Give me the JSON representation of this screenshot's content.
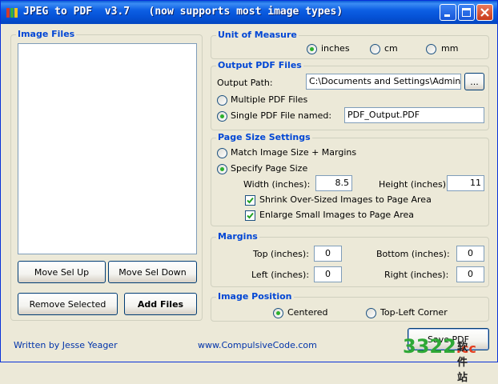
{
  "window": {
    "title": "JPEG to PDF  v3.7   (now supports most image types)"
  },
  "image_files": {
    "title": "Image Files",
    "items": [],
    "move_up_label": "Move Sel Up",
    "move_down_label": "Move Sel Down",
    "remove_label": "Remove Selected",
    "add_label": "Add Files"
  },
  "unit": {
    "title": "Unit of Measure",
    "options": [
      "inches",
      "cm",
      "mm"
    ],
    "selected": "inches"
  },
  "output": {
    "title": "Output PDF Files",
    "path_label": "Output Path:",
    "path_value": "C:\\Documents and Settings\\Administrat",
    "browse_label": "...",
    "multiple_label": "Multiple PDF Files",
    "single_label": "Single PDF File named:",
    "single_value": "PDF_Output.PDF",
    "mode": "single"
  },
  "page_size": {
    "title": "Page Size Settings",
    "match_label": "Match Image Size + Margins",
    "specify_label": "Specify Page Size",
    "mode": "specify",
    "width_label": "Width (inches):",
    "width_value": "8.5",
    "height_label": "Height (inches):",
    "height_value": "11",
    "shrink_label": "Shrink Over-Sized Images to Page Area",
    "shrink_checked": true,
    "enlarge_label": "Enlarge Small Images to Page Area",
    "enlarge_checked": true
  },
  "margins": {
    "title": "Margins",
    "top_label": "Top (inches):",
    "top_value": "0",
    "bottom_label": "Bottom (inches):",
    "bottom_value": "0",
    "left_label": "Left (inches):",
    "left_value": "0",
    "right_label": "Right (inches):",
    "right_value": "0"
  },
  "position": {
    "title": "Image Position",
    "centered_label": "Centered",
    "topleft_label": "Top-Left Corner",
    "selected": "centered"
  },
  "footer": {
    "author": "Written by Jesse Yeager",
    "website": "www.CompulsiveCode.com",
    "save_label": "Save PDF"
  },
  "watermark": {
    "digits": "3322",
    "tld": ".cc",
    "cn": "软件站"
  },
  "colors": {
    "title_bar": "#0552d6",
    "group_title": "#0046d5",
    "window_bg": "#ece9d8",
    "radio_dot": "#2cb02c",
    "close_button": "#c8391b"
  }
}
